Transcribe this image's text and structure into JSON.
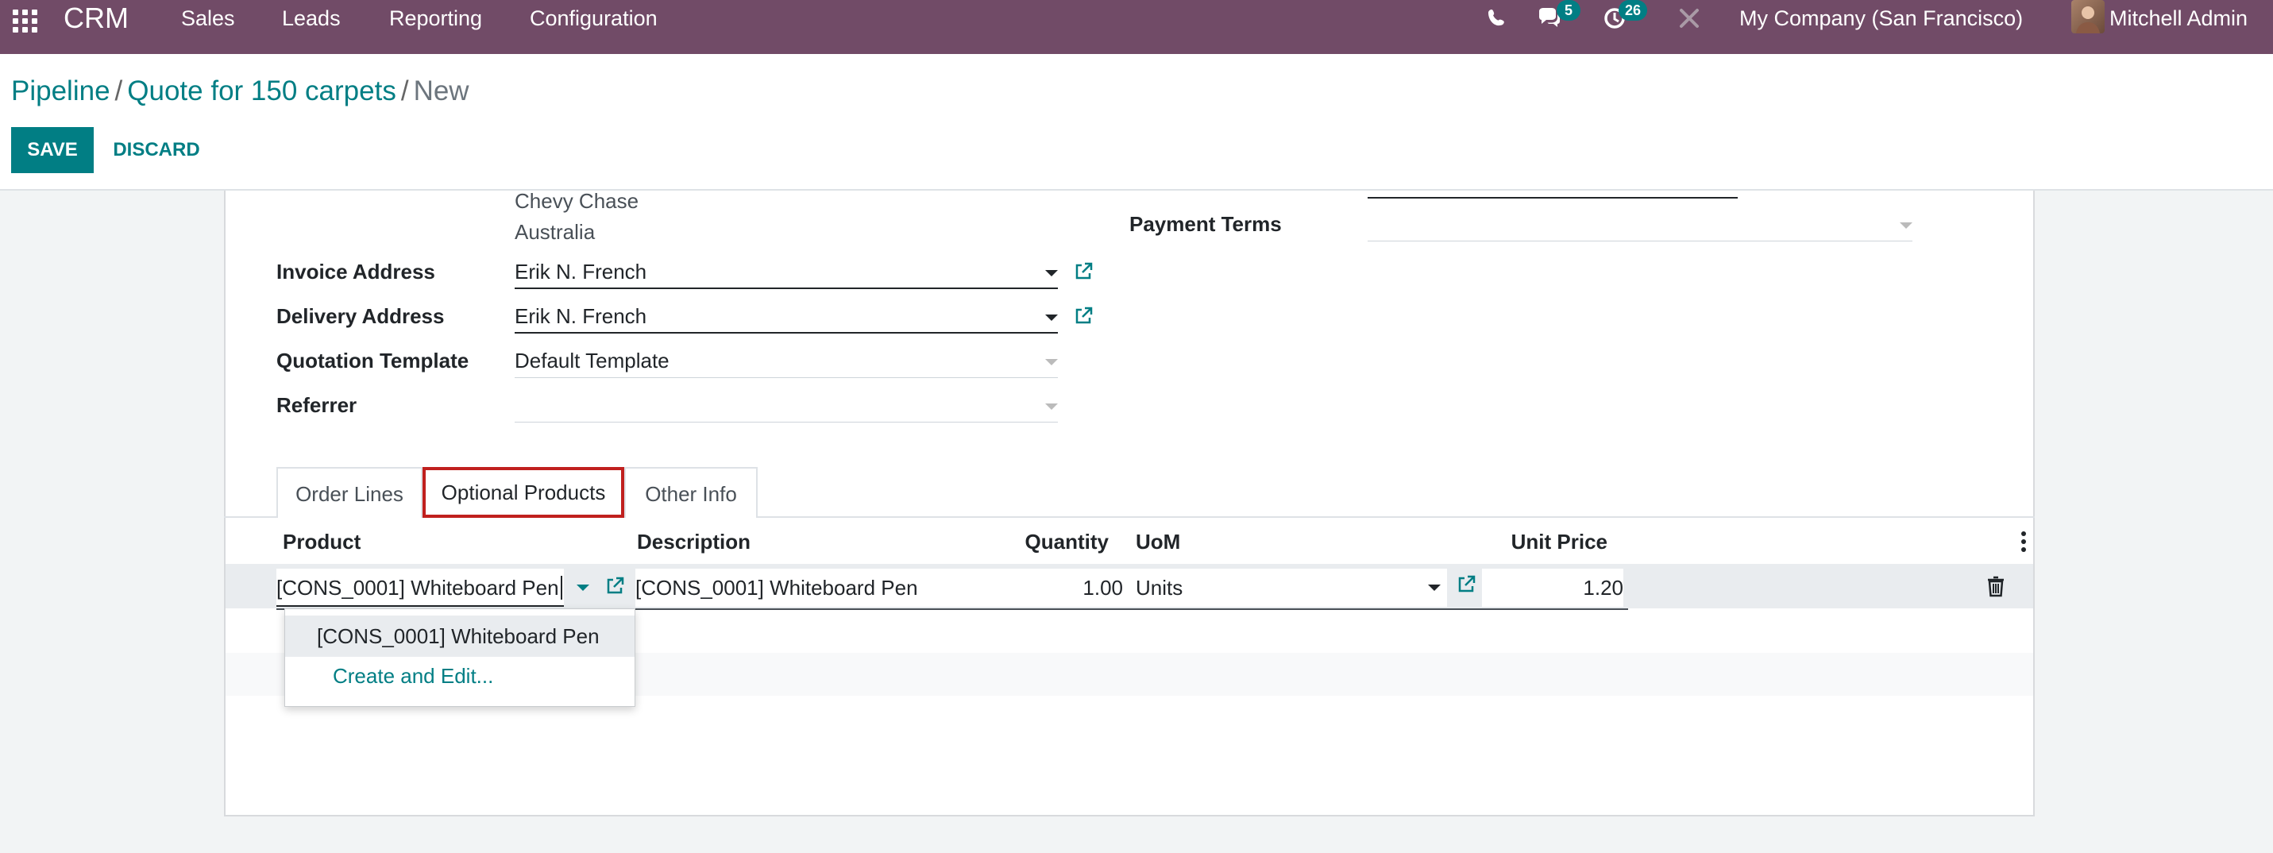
{
  "navbar": {
    "brand": "CRM",
    "menus": [
      "Sales",
      "Leads",
      "Reporting",
      "Configuration"
    ],
    "messages_count": "5",
    "activities_count": "26",
    "company": "My Company (San Francisco)",
    "user": "Mitchell Admin",
    "icons": [
      "apps-grid-icon",
      "phone-icon",
      "chat-icon",
      "clock-icon",
      "tools-icon"
    ]
  },
  "breadcrumb": {
    "items": [
      "Pipeline",
      "Quote for 150 carpets"
    ],
    "current": "New"
  },
  "actions": {
    "save": "SAVE",
    "discard": "DISCARD"
  },
  "form": {
    "address_lines": [
      "Chevy Chase",
      "Australia"
    ],
    "invoice_address": {
      "label": "Invoice Address",
      "value": "Erik N. French"
    },
    "delivery_address": {
      "label": "Delivery Address",
      "value": "Erik N. French"
    },
    "quotation_template": {
      "label": "Quotation Template",
      "value": "Default Template"
    },
    "referrer": {
      "label": "Referrer",
      "value": ""
    },
    "payment_terms": {
      "label": "Payment Terms",
      "value": ""
    }
  },
  "tabs": [
    {
      "label": "Order Lines",
      "active": false
    },
    {
      "label": "Optional Products",
      "active": true
    },
    {
      "label": "Other Info",
      "active": false
    }
  ],
  "table": {
    "headers": {
      "product": "Product",
      "description": "Description",
      "quantity": "Quantity",
      "uom": "UoM",
      "unit_price": "Unit Price"
    },
    "row": {
      "product": "[CONS_0001] Whiteboard Pen",
      "description": "[CONS_0001] Whiteboard Pen",
      "quantity": "1.00",
      "uom": "Units",
      "unit_price": "1.20"
    }
  },
  "autocomplete": {
    "options": [
      "[CONS_0001] Whiteboard Pen"
    ],
    "create_label": "Create and Edit..."
  },
  "colors": {
    "navbar": "#714b67",
    "primary": "#017e84",
    "highlight_border": "#c0201e"
  }
}
